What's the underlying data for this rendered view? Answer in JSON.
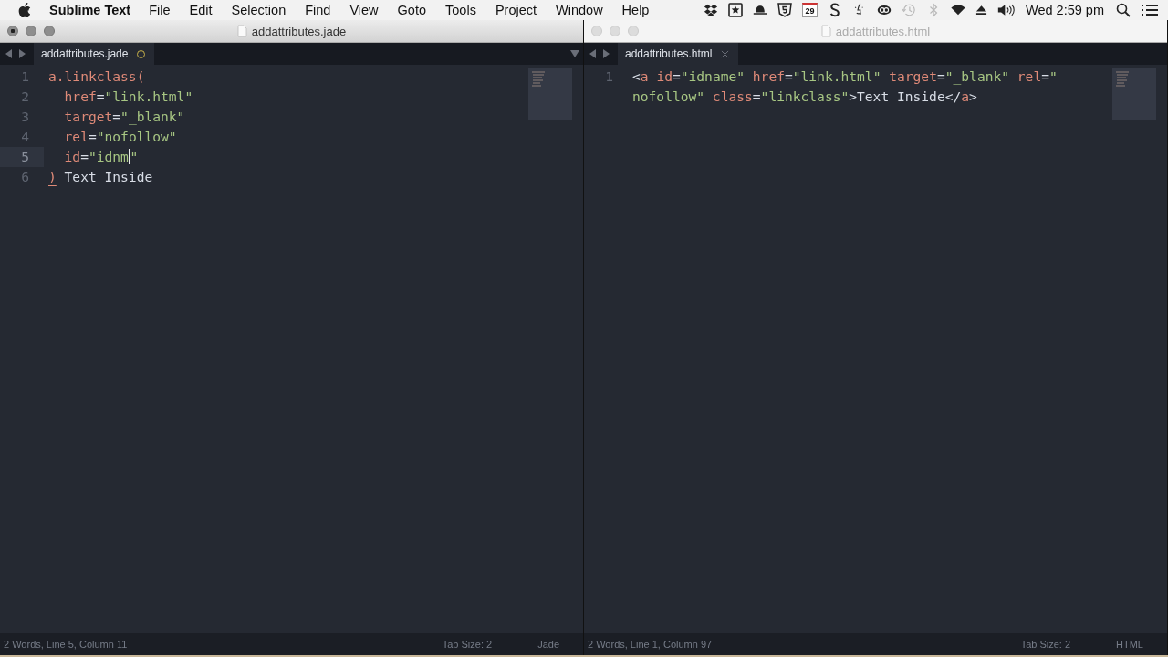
{
  "menubar": {
    "app": "Sublime Text",
    "menus": [
      "File",
      "Edit",
      "Selection",
      "Find",
      "View",
      "Goto",
      "Tools",
      "Project",
      "Window",
      "Help"
    ],
    "status_icons": [
      {
        "kind": "dropbox",
        "disabled": false
      },
      {
        "kind": "starbox",
        "disabled": false
      },
      {
        "kind": "hat",
        "disabled": false
      },
      {
        "kind": "shield",
        "disabled": false
      },
      {
        "kind": "calendar",
        "label": "29",
        "disabled": false
      },
      {
        "kind": "s",
        "disabled": false
      },
      {
        "kind": "finder",
        "disabled": false
      },
      {
        "kind": "cloud",
        "disabled": false
      },
      {
        "kind": "clock",
        "disabled": true
      },
      {
        "kind": "bluetooth",
        "disabled": true
      },
      {
        "kind": "wifi",
        "disabled": false
      },
      {
        "kind": "eject",
        "disabled": false
      },
      {
        "kind": "volume",
        "disabled": false
      }
    ],
    "clock": "Wed 2:59 pm"
  },
  "windows": [
    {
      "title": "addattributes.jade",
      "active": true,
      "unsaved": true,
      "tab": {
        "label": "addattributes.jade",
        "modified": true
      },
      "lines": [
        {
          "number": "1",
          "current": false,
          "segments": [
            {
              "spans": [
                {
                  "kind": "tag",
                  "text": "a.linkclass("
                }
              ]
            }
          ]
        },
        {
          "number": "2",
          "current": false,
          "segments": [
            {
              "spans": [
                {
                  "kind": "attr",
                  "text": "  href"
                },
                {
                  "kind": "punct",
                  "text": "="
                },
                {
                  "kind": "string",
                  "text": "\"link.html\""
                }
              ]
            }
          ]
        },
        {
          "number": "3",
          "current": false,
          "segments": [
            {
              "spans": [
                {
                  "kind": "attr",
                  "text": "  target"
                },
                {
                  "kind": "punct",
                  "text": "="
                },
                {
                  "kind": "string",
                  "text": "\"_blank\""
                }
              ]
            }
          ]
        },
        {
          "number": "4",
          "current": false,
          "segments": [
            {
              "spans": [
                {
                  "kind": "attr",
                  "text": "  rel"
                },
                {
                  "kind": "punct",
                  "text": "="
                },
                {
                  "kind": "string",
                  "text": "\"nofollow\""
                }
              ]
            }
          ]
        },
        {
          "number": "5",
          "current": true,
          "segments": [
            {
              "spans": [
                {
                  "kind": "attr",
                  "text": "  id"
                },
                {
                  "kind": "punct",
                  "text": "="
                },
                {
                  "kind": "string",
                  "text": "\"idnm",
                  "cursor": true
                },
                {
                  "kind": "string",
                  "text": "\""
                }
              ]
            }
          ]
        },
        {
          "number": "6",
          "current": false,
          "segments": [
            {
              "spans": [
                {
                  "kind": "tag",
                  "text": ")",
                  "matched": true
                },
                {
                  "kind": "text",
                  "text": " Text Inside"
                }
              ]
            }
          ]
        }
      ],
      "status": {
        "position": "2 Words, Line 5, Column 11",
        "tab_size": "Tab Size: 2",
        "syntax": "Jade"
      }
    },
    {
      "title": "addattributes.html",
      "active": false,
      "unsaved": false,
      "tab": {
        "label": "addattributes.html",
        "modified": false
      },
      "lines": [
        {
          "number": "1",
          "current": false,
          "segments": [
            {
              "spans": [
                {
                  "kind": "punct",
                  "text": "<"
                },
                {
                  "kind": "tag",
                  "text": "a"
                },
                {
                  "kind": "attr",
                  "text": " id"
                },
                {
                  "kind": "punct",
                  "text": "="
                },
                {
                  "kind": "string",
                  "text": "\"idname\""
                },
                {
                  "kind": "attr",
                  "text": " href"
                },
                {
                  "kind": "punct",
                  "text": "="
                },
                {
                  "kind": "string",
                  "text": "\"link.html\""
                },
                {
                  "kind": "attr",
                  "text": " target"
                },
                {
                  "kind": "punct",
                  "text": "="
                },
                {
                  "kind": "string",
                  "text": "\"_blank\""
                },
                {
                  "kind": "attr",
                  "text": " rel"
                },
                {
                  "kind": "punct",
                  "text": "="
                },
                {
                  "kind": "string",
                  "text": "\""
                }
              ]
            },
            {
              "spans": [
                {
                  "kind": "string",
                  "text": "nofollow\""
                },
                {
                  "kind": "attr",
                  "text": " class"
                },
                {
                  "kind": "punct",
                  "text": "="
                },
                {
                  "kind": "string",
                  "text": "\"linkclass\""
                },
                {
                  "kind": "punct",
                  "text": ">"
                },
                {
                  "kind": "text",
                  "text": "Text Inside"
                },
                {
                  "kind": "punct",
                  "text": "</"
                },
                {
                  "kind": "tag",
                  "text": "a"
                },
                {
                  "kind": "punct",
                  "text": ">"
                }
              ]
            }
          ]
        }
      ],
      "status": {
        "position": "2 Words, Line 1, Column 97",
        "tab_size": "Tab Size: 2",
        "syntax": "HTML"
      }
    }
  ]
}
